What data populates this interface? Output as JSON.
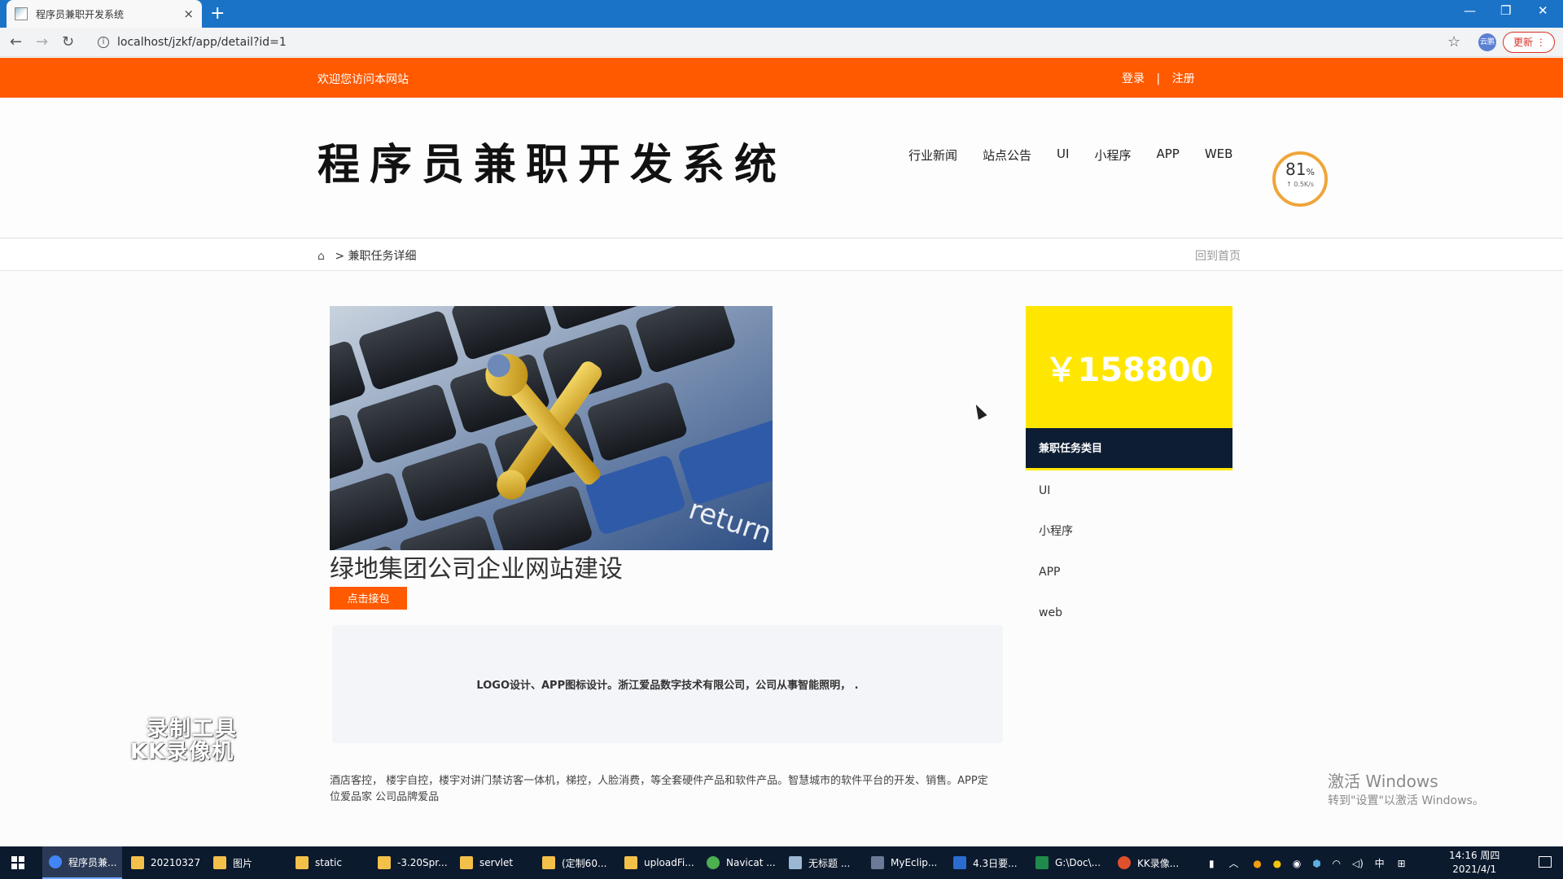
{
  "browser": {
    "tab_title": "程序员兼职开发系统",
    "tab_close": "×",
    "new_tab": "+",
    "url": "localhost/jzkf/app/detail?id=1",
    "profile_label": "云鹏",
    "update_label": "更新 ⋮"
  },
  "topbar": {
    "welcome": "欢迎您访问本网站",
    "login": "登录",
    "separator": "|",
    "register": "注册"
  },
  "header": {
    "logo": "程序员兼职开发系统",
    "nav": [
      "行业新闻",
      "站点公告",
      "UI",
      "小程序",
      "APP",
      "WEB"
    ]
  },
  "widget": {
    "percent": "81",
    "percent_unit": "%",
    "speed": "↑ 0.5K/s"
  },
  "breadcrumb": {
    "separator": ">",
    "current": "兼职任务详细",
    "back_home": "回到首页"
  },
  "task": {
    "title": "绿地集团公司企业网站建设",
    "accept_button": "点击接包",
    "summary": "LOGO设计、APP图标设计。浙江爱品数字技术有限公司，公司从事智能照明， .",
    "description": "酒店客控， 楼宇自控，楼宇对讲门禁访客一体机，梯控，人脸消费，等全套硬件产品和软件产品。智慧城市的软件平台的开发、销售。APP定位爱品家 公司品牌爱品",
    "image_text": "return"
  },
  "sidebar": {
    "price": "￥158800",
    "category_title": "兼职任务类目",
    "categories": [
      "UI",
      "小程序",
      "APP",
      "web"
    ]
  },
  "overlay": {
    "watermark_line1": "录制工具",
    "watermark_line2": "KK录像机",
    "activate_title": "激活 Windows",
    "activate_hint": "转到\"设置\"以激活 Windows。"
  },
  "taskbar": {
    "items": [
      "程序员兼...",
      "20210327",
      "图片",
      "static",
      "-3.20Spr...",
      "servlet",
      "(定制60...",
      "uploadFi...",
      "Navicat ...",
      "无标题 ...",
      "MyEclip...",
      "4.3日要...",
      "G:\\Doc\\...",
      "KK录像..."
    ],
    "ime": "中",
    "time": "14:16 周四",
    "date": "2021/4/1"
  },
  "colors": {
    "orange": "#ff5a00",
    "yellow": "#ffe600",
    "navy": "#0d1d33"
  }
}
